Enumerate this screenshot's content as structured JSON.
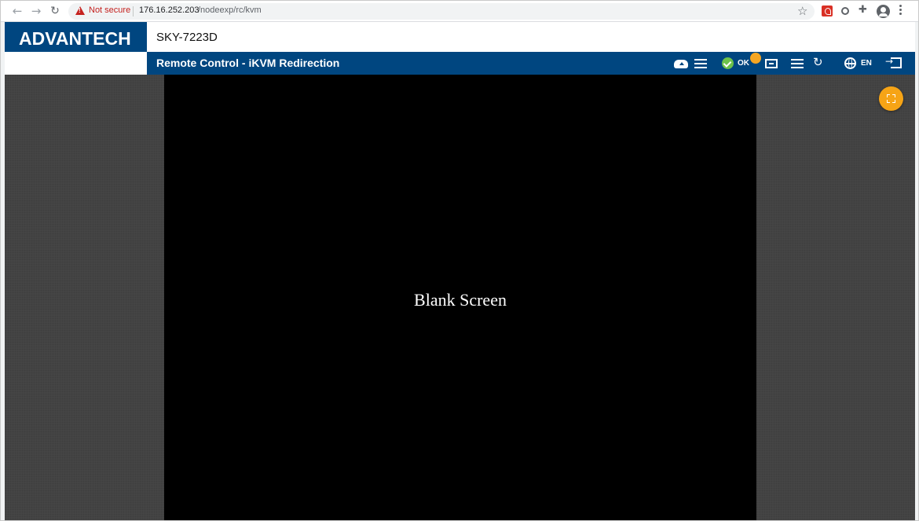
{
  "browser": {
    "security_label": "Not secure",
    "url_host": "176.16.252.203",
    "url_path": "/nodeexp/rc/kvm",
    "icons": [
      "back-arrow-icon",
      "forward-arrow-icon",
      "reload-icon",
      "warning-icon",
      "bookmark-star-icon",
      "pdf-extension-icon",
      "extension-icon",
      "puzzle-extensions-icon",
      "profile-icon",
      "menu-kebab-icon"
    ]
  },
  "app": {
    "brand": "ADVANTECH",
    "device_name": "SKY-7223D",
    "page_title": "Remote Control - iKVM Redirection",
    "brand_color": "#004680",
    "accent_color": "#f6a416"
  },
  "toolbar": {
    "status_text": "OK",
    "status_color": "#6cc24a",
    "language": "EN",
    "icons": [
      "cloud-upload-icon",
      "list-icon",
      "status-check-icon",
      "display-icon",
      "list-icon",
      "refresh-icon",
      "globe-icon",
      "logout-icon"
    ]
  },
  "kvm": {
    "screen_message": "Blank Screen",
    "fullscreen_icon": "fullscreen-icon"
  }
}
